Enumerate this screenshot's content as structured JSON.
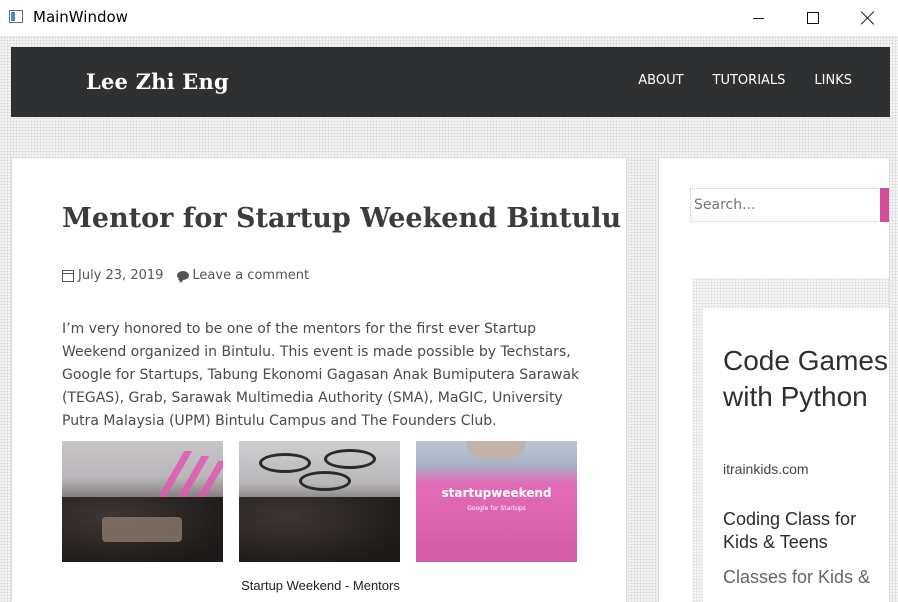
{
  "window": {
    "title": "MainWindow",
    "minimize_icon": "minimize-icon",
    "maximize_icon": "maximize-icon",
    "close_icon": "close-icon"
  },
  "site": {
    "title": "Lee Zhi Eng",
    "nav": [
      "ABOUT",
      "TUTORIALS",
      "LINKS"
    ]
  },
  "post": {
    "title": "Mentor for Startup Weekend Bintulu",
    "date": "July 23, 2019",
    "comment_link": "Leave a comment",
    "body": "I’m very honored to be one of the mentors for the first ever Startup Weekend organized in Bintulu. This event is made possible by Techstars, Google for Startups, Tabung Ekonomi Gagasan Anak Bumiputera Sarawak (TEGAS), Grab, Sarawak Multimedia Authority (SMA), MaGIC, University Putra Malaysia (UPM) Bintulu Campus and The Founders Club.",
    "gallery_caption": "Startup Weekend - Mentors",
    "tshirt_text": "startupweekend",
    "tshirt_subtext": "Google for Startups"
  },
  "sidebar": {
    "search_placeholder": "Search...",
    "ad": {
      "title": "Code Games with Python",
      "domain": "itrainkids.com",
      "heading": "Coding Class for Kids & Teens",
      "subheading": "Classes for Kids &"
    }
  },
  "colors": {
    "header_bg": "#2f3032",
    "accent": "#d54c99"
  }
}
